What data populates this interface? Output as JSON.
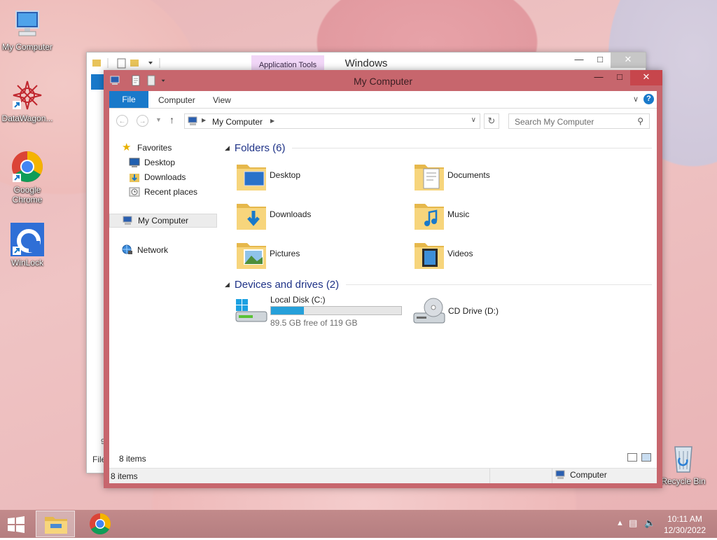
{
  "desktop": {
    "icons": [
      {
        "label": "My Computer",
        "icon": "computer-icon"
      },
      {
        "label": "DataWagon...",
        "icon": "datawagon-icon"
      },
      {
        "label": "Google Chrome",
        "icon": "chrome-icon"
      },
      {
        "label": "WinLock",
        "icon": "winlock-icon"
      },
      {
        "label": "Recycle Bin",
        "icon": "recycle-bin-icon"
      }
    ]
  },
  "background_window": {
    "title": "Windows",
    "context_tab": "Application Tools",
    "status_left": "File",
    "status_num": "9",
    "context_tab_color": "#f1d6f7"
  },
  "window": {
    "title": "My Computer",
    "accent_color": "#c7666d",
    "ribbon": {
      "file_tab": "File",
      "tabs": [
        "Computer",
        "View"
      ],
      "help": "?"
    },
    "address": {
      "crumb": "My Computer",
      "search_placeholder": "Search My Computer"
    },
    "nav": {
      "favorites": "Favorites",
      "desktop": "Desktop",
      "downloads": "Downloads",
      "recent": "Recent places",
      "computer": "My Computer",
      "network": "Network"
    },
    "folders_header": "Folders (6)",
    "folders": [
      "Desktop",
      "Documents",
      "Downloads",
      "Music",
      "Pictures",
      "Videos"
    ],
    "drives_header": "Devices and drives (2)",
    "drives": {
      "c_name": "Local Disk (C:)",
      "c_free": "89.5 GB free of 119 GB",
      "c_used_fraction": 0.25,
      "d_name": "CD Drive (D:)"
    },
    "status": {
      "items": "8 items",
      "items_bottom": "8 items",
      "zone": "Computer"
    }
  },
  "taskbar": {
    "time": "10:11 AM",
    "date": "12/30/2022"
  }
}
